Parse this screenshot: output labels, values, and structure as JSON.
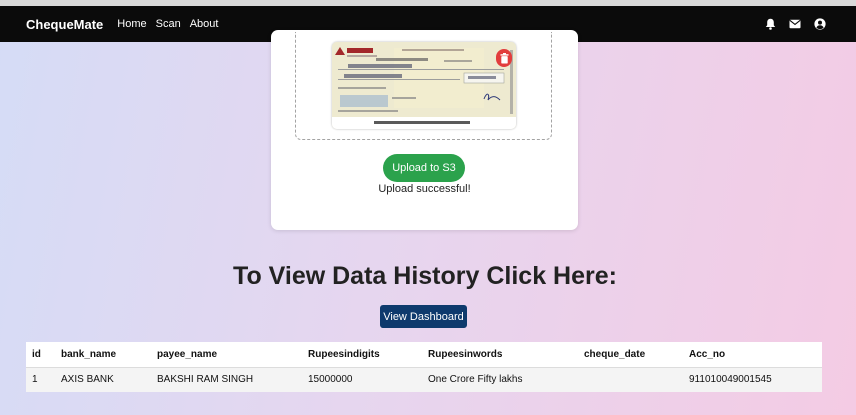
{
  "navbar": {
    "brand": "ChequeMate",
    "links": [
      "Home",
      "Scan",
      "About"
    ],
    "icons": [
      "bell-icon",
      "envelope-icon",
      "user-circle-icon"
    ]
  },
  "upload": {
    "button_label": "Upload to S3",
    "status": "Upload successful!",
    "preview_icon": "cheque-image",
    "delete_icon": "trash-icon"
  },
  "history": {
    "title": "To View Data History Click Here:",
    "dashboard_button": "View Dashboard"
  },
  "table": {
    "headers": [
      "id",
      "bank_name",
      "payee_name",
      "Rupeesindigits",
      "Rupeesinwords",
      "cheque_date",
      "Acc_no"
    ],
    "rows": [
      [
        "1",
        "AXIS BANK",
        "BAKSHI RAM SINGH",
        "15000000",
        "One Crore Fifty lakhs",
        "",
        "911010049001545"
      ]
    ]
  },
  "colors": {
    "navbar_bg": "#0b0b0b",
    "upload_button": "#2ba24c",
    "dashboard_button": "#0e3a6d",
    "delete_button": "#e23d3d"
  }
}
